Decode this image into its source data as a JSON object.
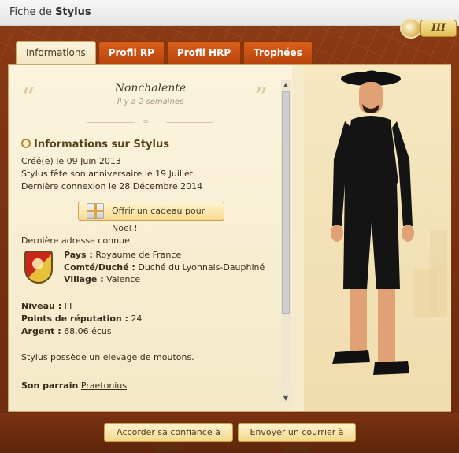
{
  "window": {
    "title_prefix": "Fiche de",
    "title_name": "Stylus"
  },
  "badge": {
    "level": "III"
  },
  "tabs": [
    {
      "label": "Informations",
      "active": true
    },
    {
      "label": "Profil RP",
      "active": false
    },
    {
      "label": "Profil HRP",
      "active": false
    },
    {
      "label": "Trophées",
      "active": false
    }
  ],
  "mood": {
    "text": "Nonchalente",
    "time": "Il y a 2 semaines"
  },
  "info": {
    "title": "Informations sur Stylus",
    "created": "Créé(e) le 09 Juin 2013",
    "birthday": "Stylus fête son anniversaire le 19 Juillet.",
    "last_login": "Dernière connexion le 28 Décembre 2014"
  },
  "gift_button": "Offrir un cadeau pour Noel !",
  "address": {
    "heading": "Dernière adresse connue",
    "pays_label": "Pays :",
    "pays_value": "Royaume de France",
    "comte_label": "Comté/Duché :",
    "comte_value": "Duché du Lyonnais-Dauphiné",
    "village_label": "Village :",
    "village_value": "Valence"
  },
  "stats": {
    "niveau_label": "Niveau :",
    "niveau_value": "III",
    "reputation_label": "Points de réputation :",
    "reputation_value": "24",
    "argent_label": "Argent :",
    "argent_value": "68,06 écus"
  },
  "description": "Stylus possède un elevage de moutons.",
  "sponsor": {
    "label": "Son parrain",
    "name": "Praetonius"
  },
  "actions": {
    "confidence": "Accorder sa confiance à Stylus",
    "mail": "Envoyer un courrier à Stylus"
  },
  "colors": {
    "frame": "#7a3210",
    "tab": "#c8501a",
    "panel": "#f5ebcc",
    "button": "#f6dc92"
  }
}
